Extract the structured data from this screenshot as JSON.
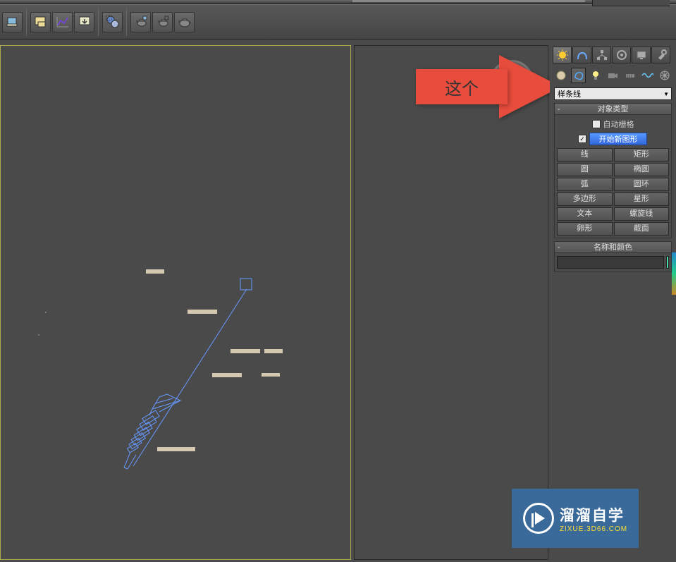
{
  "annotation": {
    "text": "这个"
  },
  "toolbar": {
    "icons": [
      "render-setup",
      "render-frame",
      "render-graph",
      "render-output",
      "material-editor",
      "teapot-1",
      "teapot-2",
      "teapot-3"
    ]
  },
  "right_panel": {
    "tabs": [
      "create",
      "modify",
      "hierarchy",
      "motion",
      "display",
      "utilities"
    ],
    "subcategories": [
      "standard",
      "shapes",
      "lights",
      "cameras",
      "helpers",
      "spacewarps",
      "systems"
    ],
    "dropdown": "样条线",
    "object_type": {
      "header": "对象类型",
      "autogrid": "自动栅格",
      "start_new": "开始新图形",
      "buttons": [
        "线",
        "矩形",
        "圆",
        "椭圆",
        "弧",
        "圆环",
        "多边形",
        "星形",
        "文本",
        "螺旋线",
        "卵形",
        "截面"
      ]
    },
    "name_color": {
      "header": "名称和颜色",
      "name_value": "",
      "color": "#44ddaa"
    }
  },
  "watermark": {
    "title": "溜溜自学",
    "sub": "ZIXUE.3D66.COM"
  }
}
